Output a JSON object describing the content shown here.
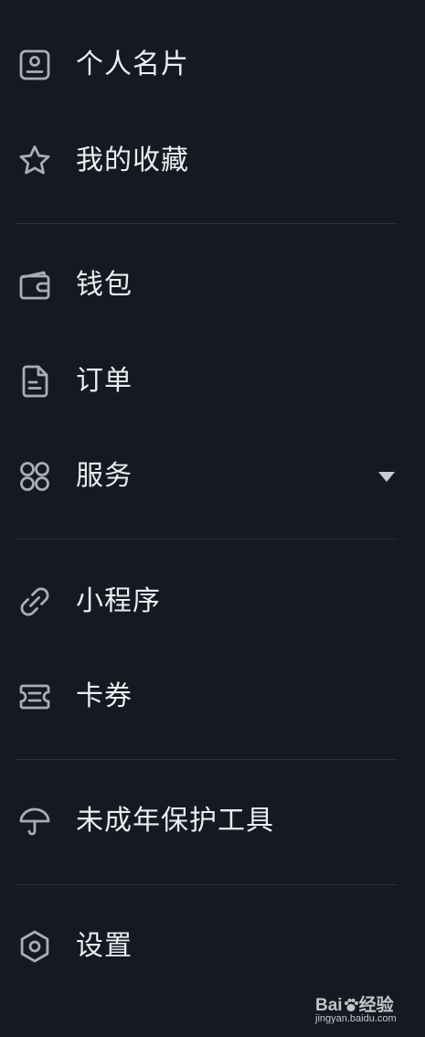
{
  "menu": {
    "items": [
      {
        "key": "profile",
        "label": "个人名片",
        "icon": "profile-card-icon"
      },
      {
        "key": "favorites",
        "label": "我的收藏",
        "icon": "star-icon"
      },
      {
        "key": "wallet",
        "label": "钱包",
        "icon": "wallet-icon"
      },
      {
        "key": "orders",
        "label": "订单",
        "icon": "document-icon"
      },
      {
        "key": "services",
        "label": "服务",
        "icon": "grid-icon",
        "expand_icon": "triangle-down-icon"
      },
      {
        "key": "mini_programs",
        "label": "小程序",
        "icon": "link-icon"
      },
      {
        "key": "coupons",
        "label": "卡券",
        "icon": "ticket-icon"
      },
      {
        "key": "minor_protection",
        "label": "未成年保护工具",
        "icon": "umbrella-icon"
      },
      {
        "key": "settings",
        "label": "设置",
        "icon": "gear-icon"
      }
    ]
  },
  "watermark": {
    "logo_text_a": "Bai",
    "logo_text_b": "经验",
    "sub_text": "jingyan.baidu.com"
  },
  "colors": {
    "background": "#161922",
    "text": "#ecedf1",
    "icon": "#a9adb8",
    "divider": "#2b2f3a"
  }
}
